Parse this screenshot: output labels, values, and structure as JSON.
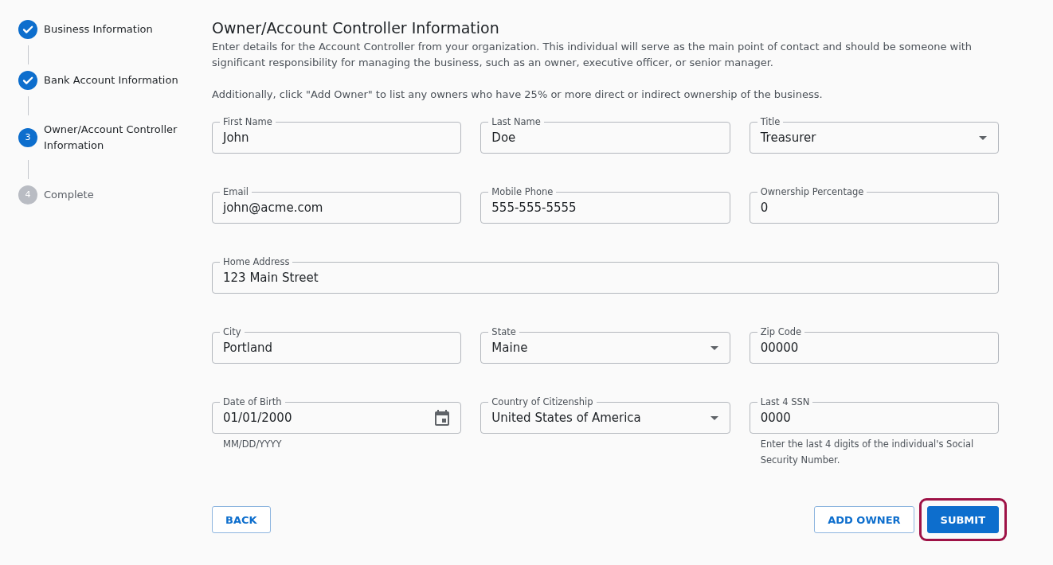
{
  "steps": [
    {
      "label": "Business Information",
      "completed": true,
      "selected": false
    },
    {
      "label": "Bank Account Information",
      "completed": true,
      "selected": false
    },
    {
      "number": "3",
      "label": "Owner/Account Controller Information",
      "completed": false,
      "selected": true
    },
    {
      "number": "4",
      "label": "Complete",
      "completed": false,
      "selected": false
    }
  ],
  "form": {
    "title": "Owner/Account Controller Information",
    "paragraphs": [
      "Enter details for the Account Controller from your organization. This individual will serve as the main point of contact and should be someone with significant responsibility for managing the business, such as an owner, executive officer, or senior manager.",
      "Additionally, click \"Add Owner\" to list any owners who have 25% or more direct or indirect ownership of the business."
    ],
    "rows": [
      [
        {
          "kind": "text",
          "label": "First Name",
          "value": "John"
        },
        {
          "kind": "text",
          "label": "Last Name",
          "value": "Doe"
        },
        {
          "kind": "select",
          "label": "Title",
          "value": "Treasurer"
        }
      ],
      [
        {
          "kind": "text",
          "label": "Email",
          "value": "john@acme.com"
        },
        {
          "kind": "text",
          "label": "Mobile Phone",
          "value": "555-555-5555"
        },
        {
          "kind": "text",
          "label": "Ownership Percentage",
          "value": "0"
        }
      ],
      [
        {
          "kind": "text",
          "label": "Home Address",
          "value": "123 Main Street"
        }
      ],
      [
        {
          "kind": "text",
          "label": "City",
          "value": "Portland"
        },
        {
          "kind": "select",
          "label": "State",
          "value": "Maine"
        },
        {
          "kind": "text",
          "label": "Zip Code",
          "value": "00000"
        }
      ],
      [
        {
          "kind": "date",
          "label": "Date of Birth",
          "value": "01/01/2000",
          "helper": "MM/DD/YYYY"
        },
        {
          "kind": "select",
          "label": "Country of Citizenship",
          "value": "United States of America"
        },
        {
          "kind": "text",
          "label": "Last 4 SSN",
          "value": "0000",
          "helper": "Enter the last 4 digits of the individual's Social Security Number."
        }
      ]
    ]
  },
  "buttons": {
    "left": [
      {
        "label": "BACK",
        "kind": "outlined",
        "highlighted": false
      }
    ],
    "right": [
      {
        "label": "ADD OWNER",
        "kind": "outlined",
        "highlighted": false
      },
      {
        "label": "SUBMIT",
        "kind": "filled",
        "highlighted": true
      }
    ]
  }
}
